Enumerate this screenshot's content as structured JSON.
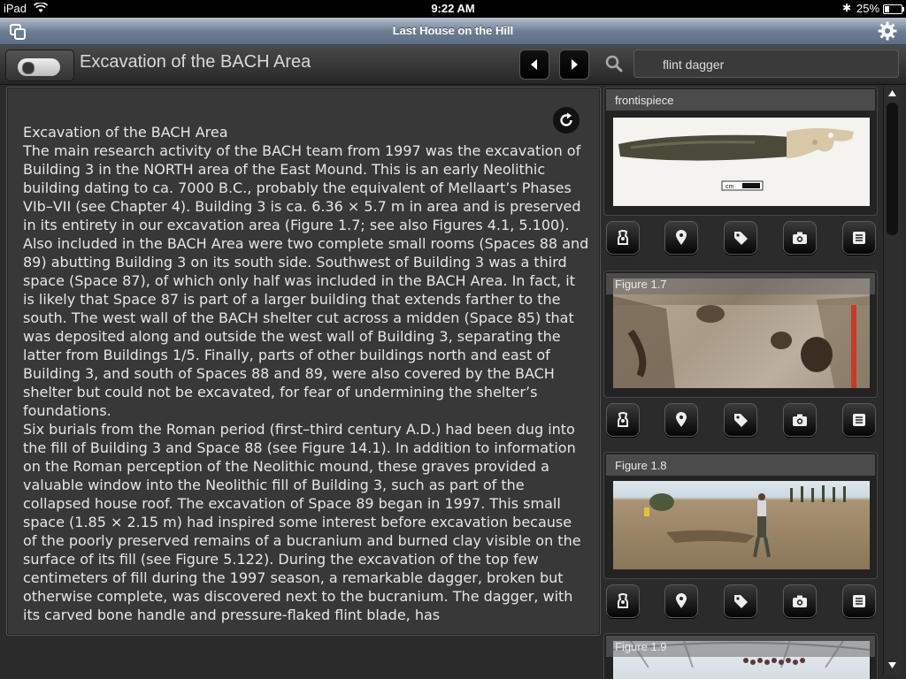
{
  "status_bar": {
    "device": "iPad",
    "time": "9:22 AM",
    "battery": "25%",
    "battery_level": 0.25
  },
  "title_bar": {
    "title": "Last House on the Hill",
    "left_icon": "copy-icon",
    "right_icon": "gear-icon"
  },
  "toolbar": {
    "title": "Excavation of the BACH Area",
    "search_value": "flint dagger",
    "prev_icon": "triangle-left",
    "next_icon": "triangle-right"
  },
  "article": {
    "heading": "Excavation of the BACH Area",
    "paragraphs": [
      "The main research activity of the BACH team from 1997 was the excavation of Building 3 in the NORTH area of the East Mound. This is an early Neolithic building dating to ca. 7000 B.C., probably the equivalent of Mellaart’s Phases VIb–VII (see Chapter 4). Building 3 is ca. 6.36 × 5.7 m in area and is preserved in its entirety in our excavation area (Figure 1.7; see also Figures 4.1, 5.100). Also included in the BACH Area were two complete small rooms (Spaces 88 and 89) abutting Building 3 on its south side. Southwest of Building 3 was a third space (Space 87), of which only half was included in the BACH Area. In fact, it is likely that Space 87 is part of a larger building that extends farther to the south. The west wall of the BACH shelter cut across a midden (Space 85) that was deposited along and outside the west wall of Building 3, separating the latter from Buildings 1/5. Finally, parts of other buildings north and east of Building 3, and south of Spaces 88 and 89, were also covered by the BACH shelter but could not be excavated, for fear of undermining the shelter’s foundations.",
      "Six burials from the Roman period (first–third century A.D.) had been dug into the fill of Building 3 and Space 88 (see Figure 14.1). In addition to information on the Roman perception of the Neolithic mound, these graves provided a valuable window into the Neolithic fill of Building 3, such as part of the collapsed house roof. The excavation of Space 89 began in 1997. This small space (1.85 × 2.15 m) had inspired some interest before excavation because of the poorly preserved remains of a bucranium and burned clay visible on the surface of its fill (see Figure 5.122). During the excavation of the top few centimeters of fill during the 1997 season, a remarkable dagger, broken but otherwise complete, was discovered next to the bucranium. The dagger, with its carved bone handle and pressure-flaked flint blade, has"
    ]
  },
  "figures": [
    {
      "label": "frontispiece",
      "subject": "flint dagger photo",
      "scale_label": "cm"
    },
    {
      "label": "Figure 1.7",
      "subject": "excavated building floor photo"
    },
    {
      "label": "Figure 1.8",
      "subject": "excavation site landscape photo"
    },
    {
      "label": "Figure 1.9",
      "subject": "shelter roof with crowd photo"
    }
  ],
  "figure_actions": [
    "person-icon",
    "map-pin-icon",
    "tag-icon",
    "camera-icon",
    "notes-icon"
  ]
}
